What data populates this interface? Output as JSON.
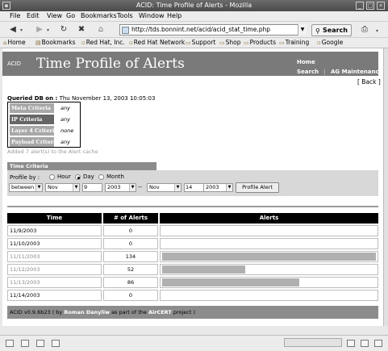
{
  "window": {
    "title": "ACID: Time Profile of Alerts - Mozilla"
  },
  "menu": [
    "File",
    "Edit",
    "View",
    "Go",
    "Bookmarks",
    "Tools",
    "Window",
    "Help"
  ],
  "nav": {
    "url": "http://tds.bonnint.net/acid/acid_stat_time.php",
    "search_label": "Search"
  },
  "bookmarks": [
    "Home",
    "Bookmarks",
    "Red Hat, Inc.",
    "Red Hat Network",
    "Support",
    "Shop",
    "Products",
    "Training",
    "Google"
  ],
  "banner": {
    "acid": "ACID",
    "title": "Time Profile of Alerts",
    "home": "Home",
    "search": "Search",
    "sep": "|",
    "ag": "AG Maintenance"
  },
  "back": "[ Back ]",
  "queried": {
    "label": "Queried DB on :",
    "value": " Thu November 13, 2003 10:05:03"
  },
  "criteria": [
    {
      "label": "Meta Criteria",
      "value": "any",
      "dark": false
    },
    {
      "label": "IP Criteria",
      "value": "any",
      "dark": true
    },
    {
      "label": "Layer 4 Criteria",
      "value": "none",
      "dark": false
    },
    {
      "label": "Payload Criteria",
      "value": "any",
      "dark": false
    }
  ],
  "added": "Added 7 alert(s) to the Alert cache",
  "time_criteria": {
    "header": "Time Criteria",
    "profile_by": "Profile by :",
    "options": [
      "Hour",
      "Day",
      "Month"
    ],
    "selected": "Day",
    "mode": "between",
    "from_month": "Nov",
    "from_day": "9",
    "from_year": "2003",
    "dash": "--",
    "to_month": "Nov",
    "to_day": "14",
    "to_year": "2003",
    "button": "Profile Alert"
  },
  "table": {
    "headers": [
      "Time",
      "# of Alerts",
      "Alerts"
    ],
    "rows": [
      {
        "date": "11/9/2003",
        "count": 0,
        "link": false
      },
      {
        "date": "11/10/2003",
        "count": 0,
        "link": false
      },
      {
        "date": "11/11/2003",
        "count": 134,
        "link": true
      },
      {
        "date": "11/12/2003",
        "count": 52,
        "link": true
      },
      {
        "date": "11/13/2003",
        "count": 86,
        "link": true
      },
      {
        "date": "11/14/2003",
        "count": 0,
        "link": false
      }
    ]
  },
  "footer": {
    "pre": "ACID v0.9.6b23 ( by ",
    "author": "Roman Danyliw",
    "mid": " as part of the ",
    "project": "AirCERT",
    "post": " project )"
  },
  "colors": {
    "banner": "#7a7a7a",
    "header": "#000000",
    "bar": "#b0b0b0",
    "footer": "#8c8c8c"
  }
}
